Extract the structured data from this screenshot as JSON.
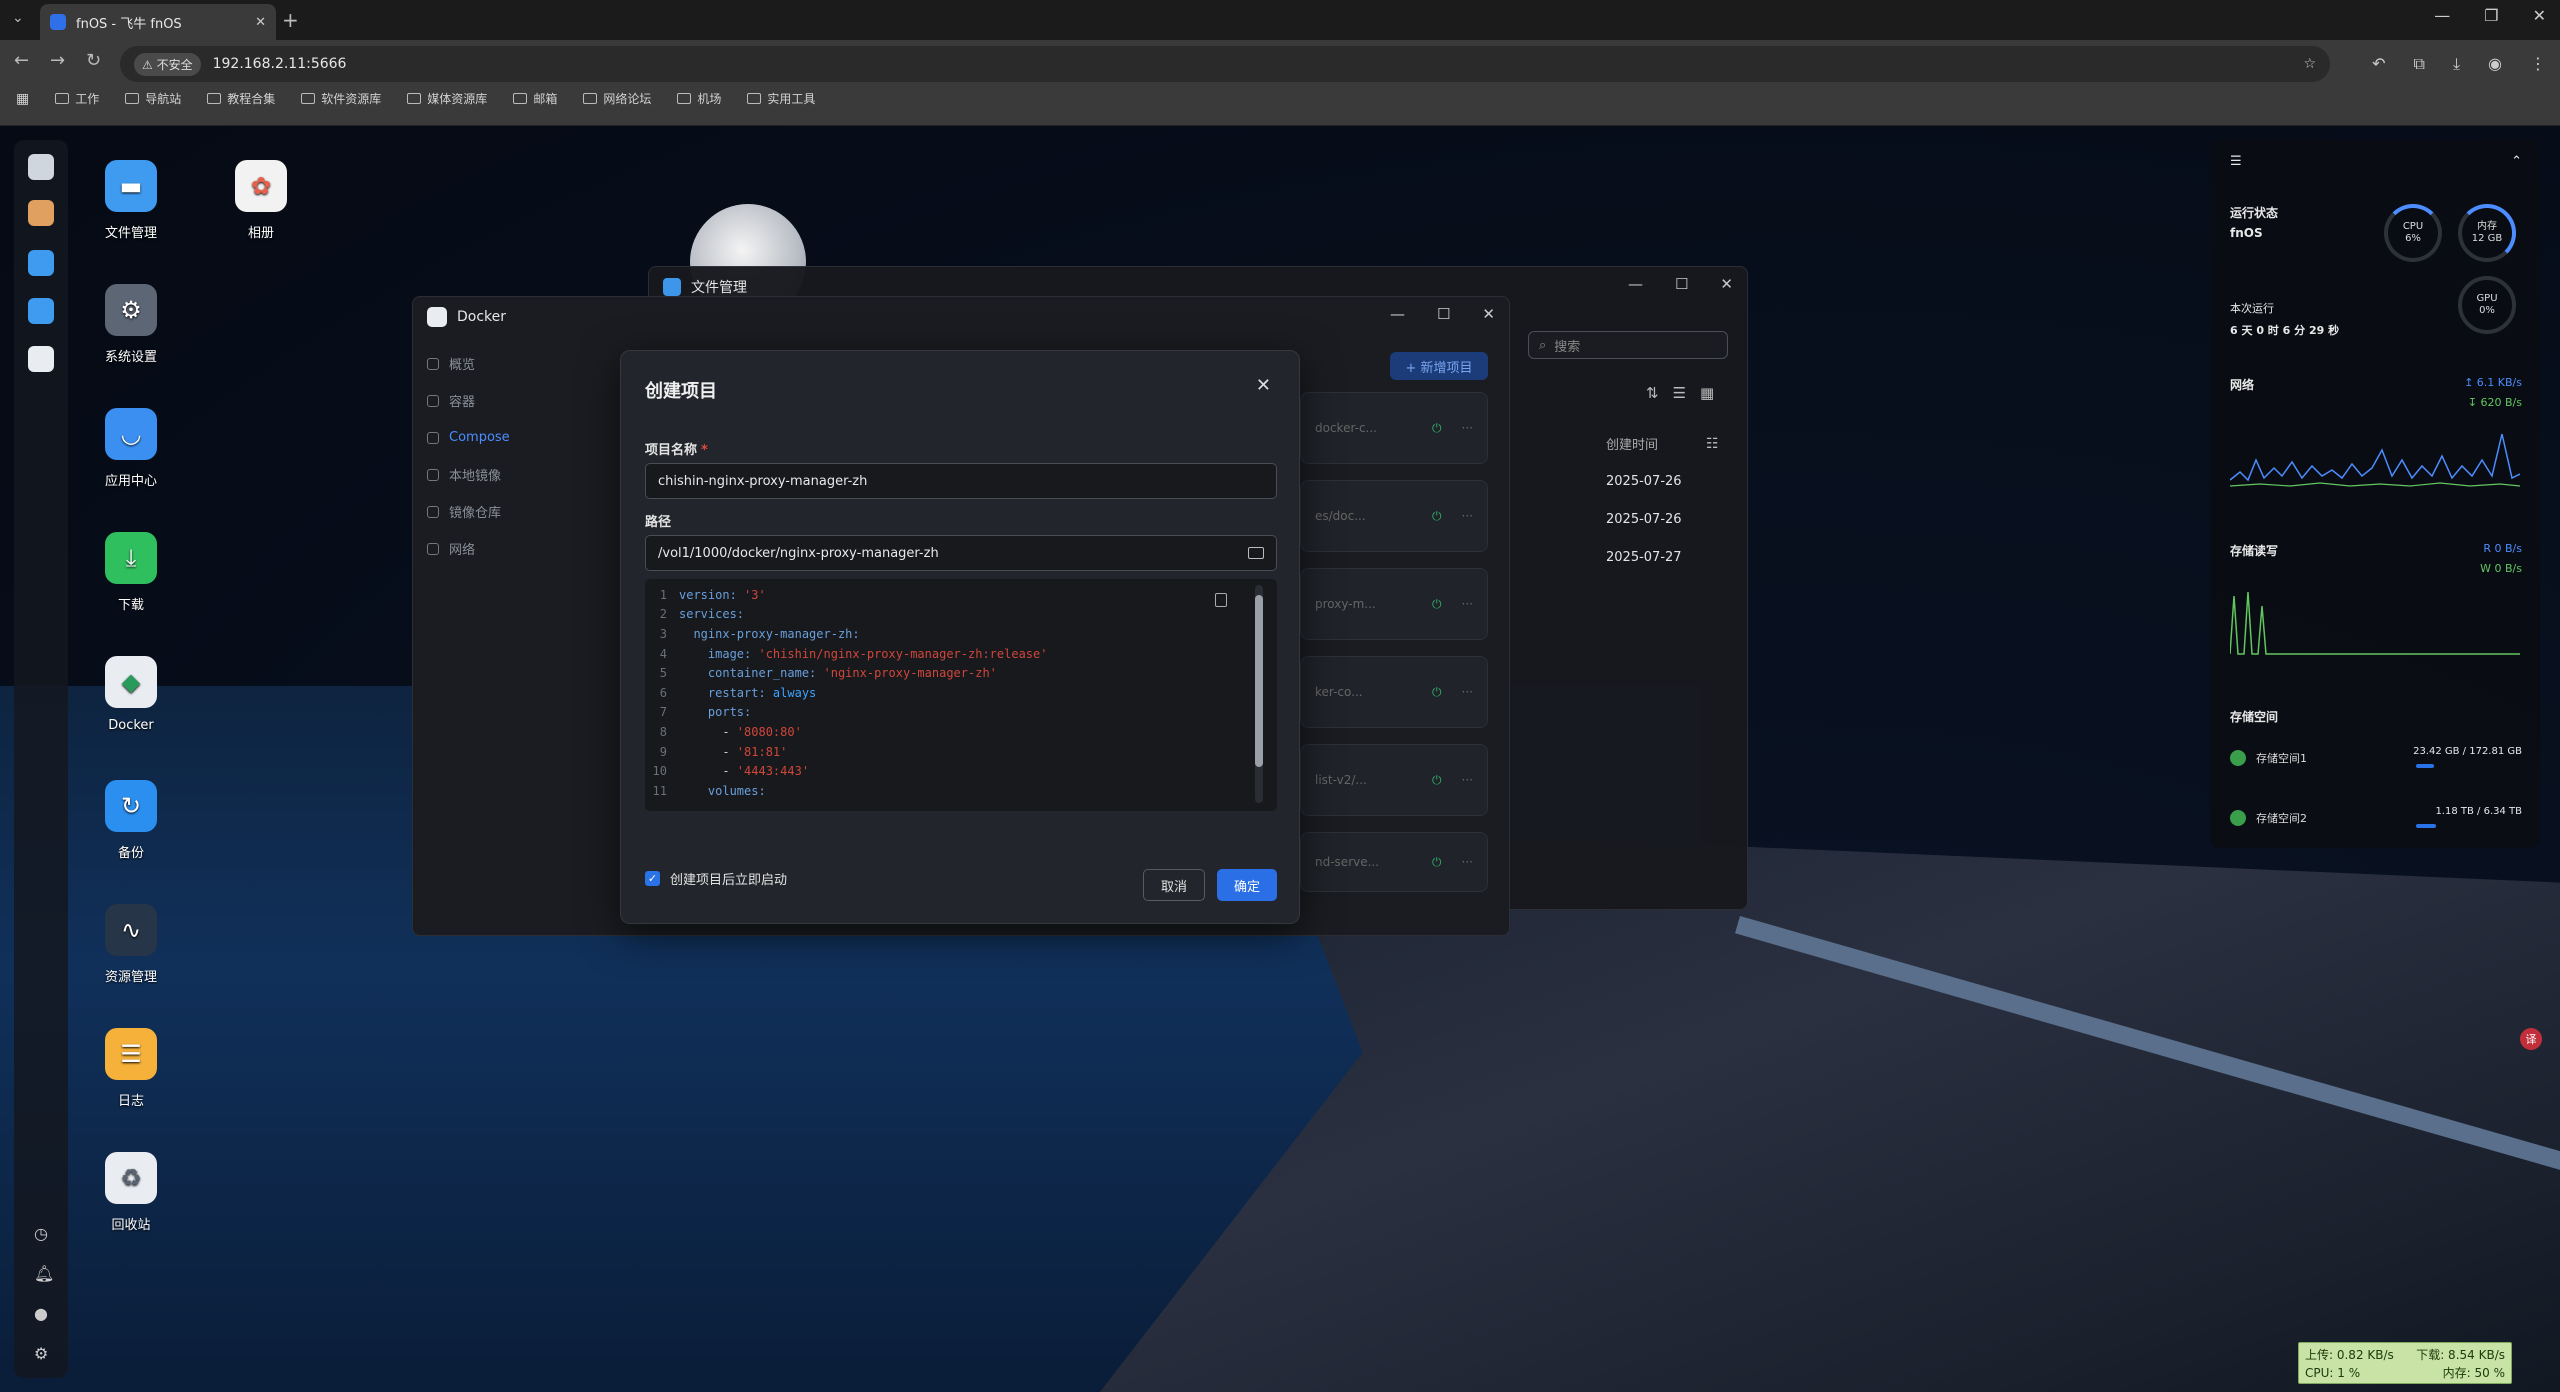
{
  "browser": {
    "tab_title": "fnOS - 飞牛 fnOS",
    "insecure_label": "不安全",
    "url": "192.168.2.11:5666",
    "bookmarks": [
      "工作",
      "导航站",
      "教程合集",
      "软件资源库",
      "媒体资源库",
      "邮箱",
      "网络论坛",
      "机场",
      "实用工具"
    ]
  },
  "desktop": {
    "icons": [
      {
        "label": "文件管理",
        "icon": "folder-icon",
        "color": "#3f9bf0"
      },
      {
        "label": "相册",
        "icon": "photos-icon",
        "color": "#f2f2f2"
      },
      {
        "label": "系统设置",
        "icon": "gear-icon",
        "color": "#5d6675"
      },
      {
        "label": "应用中心",
        "icon": "store-icon",
        "color": "#3a8ff0"
      },
      {
        "label": "下载",
        "icon": "download-icon",
        "color": "#2fbf5f"
      },
      {
        "label": "Docker",
        "icon": "docker-icon",
        "color": "#e9edf2"
      },
      {
        "label": "备份",
        "icon": "backup-icon",
        "color": "#2b8ff0"
      },
      {
        "label": "资源管理",
        "icon": "monitor-icon",
        "color": "#263548"
      },
      {
        "label": "日志",
        "icon": "log-icon",
        "color": "#f5b13a"
      },
      {
        "label": "回收站",
        "icon": "trash-icon",
        "color": "#e9edf2"
      }
    ]
  },
  "file_window": {
    "title": "文件管理",
    "search_placeholder": "搜索",
    "column_header": "创建时间",
    "dates": [
      "2025-07-26",
      "2025-07-26",
      "2025-07-27"
    ]
  },
  "docker_window": {
    "title": "Docker",
    "nav": [
      {
        "label": "概览"
      },
      {
        "label": "容器"
      },
      {
        "label": "Compose",
        "active": true
      },
      {
        "label": "本地镜像"
      },
      {
        "label": "镜像仓库"
      },
      {
        "label": "网络"
      }
    ],
    "add_button": "+ 新增项目",
    "cards": [
      "docker-c...",
      "es/doc...",
      "proxy-m...",
      "ker-co...",
      "list-v2/...",
      "nd-serve..."
    ]
  },
  "modal": {
    "title": "创建项目",
    "name_label": "项目名称",
    "name_value": "chishin-nginx-proxy-manager-zh",
    "path_label": "路径",
    "path_value": "/vol1/1000/docker/nginx-proxy-manager-zh",
    "code_lines": [
      {
        "n": "1",
        "segs": [
          {
            "t": "version: ",
            "c": "ck"
          },
          {
            "t": "'3'",
            "c": "cs"
          }
        ]
      },
      {
        "n": "2",
        "segs": [
          {
            "t": "services:",
            "c": "ck"
          }
        ]
      },
      {
        "n": "3",
        "segs": [
          {
            "t": "  nginx-proxy-manager-zh:",
            "c": "ck"
          }
        ]
      },
      {
        "n": "4",
        "segs": [
          {
            "t": "    image: ",
            "c": "ck"
          },
          {
            "t": "'chishin/nginx-proxy-manager-zh:release'",
            "c": "cs"
          }
        ]
      },
      {
        "n": "5",
        "segs": [
          {
            "t": "    container_name: ",
            "c": "ck"
          },
          {
            "t": "'nginx-proxy-manager-zh'",
            "c": "cs"
          }
        ]
      },
      {
        "n": "6",
        "segs": [
          {
            "t": "    restart: ",
            "c": "ck"
          },
          {
            "t": "always",
            "c": "cb"
          }
        ]
      },
      {
        "n": "7",
        "segs": [
          {
            "t": "    ports:",
            "c": "ck"
          }
        ]
      },
      {
        "n": "8",
        "segs": [
          {
            "t": "      - ",
            "c": "cv"
          },
          {
            "t": "'8080:80'",
            "c": "cs"
          }
        ]
      },
      {
        "n": "9",
        "segs": [
          {
            "t": "      - ",
            "c": "cv"
          },
          {
            "t": "'81:81'",
            "c": "cs"
          }
        ]
      },
      {
        "n": "10",
        "segs": [
          {
            "t": "      - ",
            "c": "cv"
          },
          {
            "t": "'4443:443'",
            "c": "cs"
          }
        ]
      },
      {
        "n": "11",
        "segs": [
          {
            "t": "    volumes:",
            "c": "ck"
          }
        ]
      }
    ],
    "checkbox_label": "创建项目后立即启动",
    "cancel": "取消",
    "confirm": "确定"
  },
  "widget": {
    "status_label": "运行状态",
    "host": "fnOS",
    "cpu_label": "CPU",
    "cpu_value": "6%",
    "cpu_fraction": 0.06,
    "mem_label": "内存",
    "mem_value": "12 GB",
    "gpu_label": "GPU",
    "gpu_value": "0%",
    "uptime_label": "本次运行",
    "uptime": "6 天 0 时 6 分 29 秒",
    "network_label": "网络",
    "net_up": "↥ 6.1 KB/s",
    "net_down": "↧ 620 B/s",
    "disk_io_label": "存储读写",
    "read": "R 0 B/s",
    "write": "W 0 B/s",
    "storage_label": "存储空间",
    "volumes": [
      {
        "name": "存储空间1",
        "usage": "23.42 GB / 172.81 GB",
        "fraction": 0.14
      },
      {
        "name": "存储空间2",
        "usage": "1.18 TB / 6.34 TB",
        "fraction": 0.19
      }
    ]
  },
  "tray": {
    "up": "上传: 0.82 KB/s",
    "down": "下载: 8.54 KB/s",
    "cpu": "CPU: 1 %",
    "mem": "内存: 50 %"
  }
}
